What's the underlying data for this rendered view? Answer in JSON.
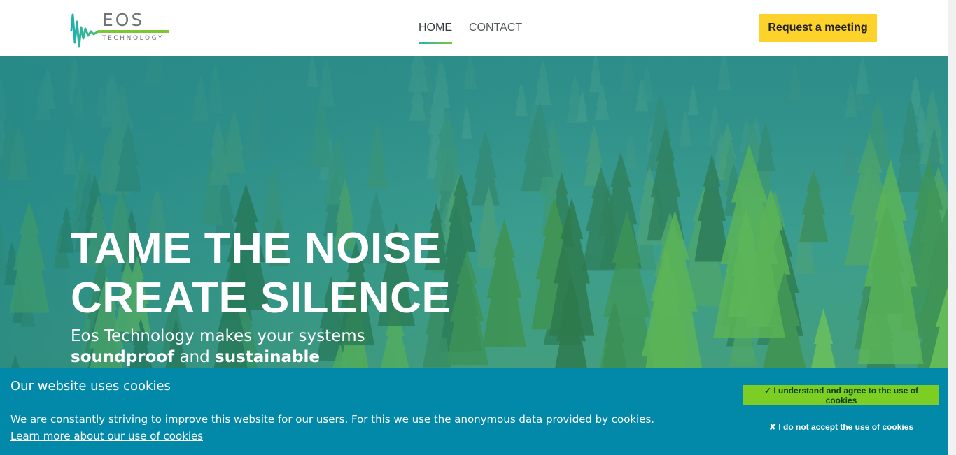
{
  "header": {
    "logo": {
      "word": "EOS",
      "sub": "TECHNOLOGY"
    },
    "nav": [
      {
        "label": "HOME",
        "active": true
      },
      {
        "label": "CONTACT",
        "active": false
      }
    ],
    "cta_label": "Request a meeting"
  },
  "hero": {
    "title_line1": "TAME THE NOISE",
    "title_line2": "CREATE SILENCE",
    "subtitle_line1": "Eos Technology makes your systems",
    "subtitle_bold1": "soundproof",
    "subtitle_and": "and",
    "subtitle_bold2": "sustainable"
  },
  "cookie_bar": {
    "title": "Our website uses cookies",
    "text": "We are constantly striving to improve this website for our users. For this we use the anonymous data provided by cookies.",
    "link": "Learn more about our use of cookies",
    "accept_label": "✓ I understand and agree to the use of cookies",
    "decline_label": "✘ I do not accept the use of cookies"
  },
  "colors": {
    "accent_yellow": "#fdd22b",
    "cookie_bar_bg": "#0289aa",
    "accept_green": "#7ccd24",
    "logo_teal": "#26b4b6",
    "logo_green": "#7dc734"
  }
}
